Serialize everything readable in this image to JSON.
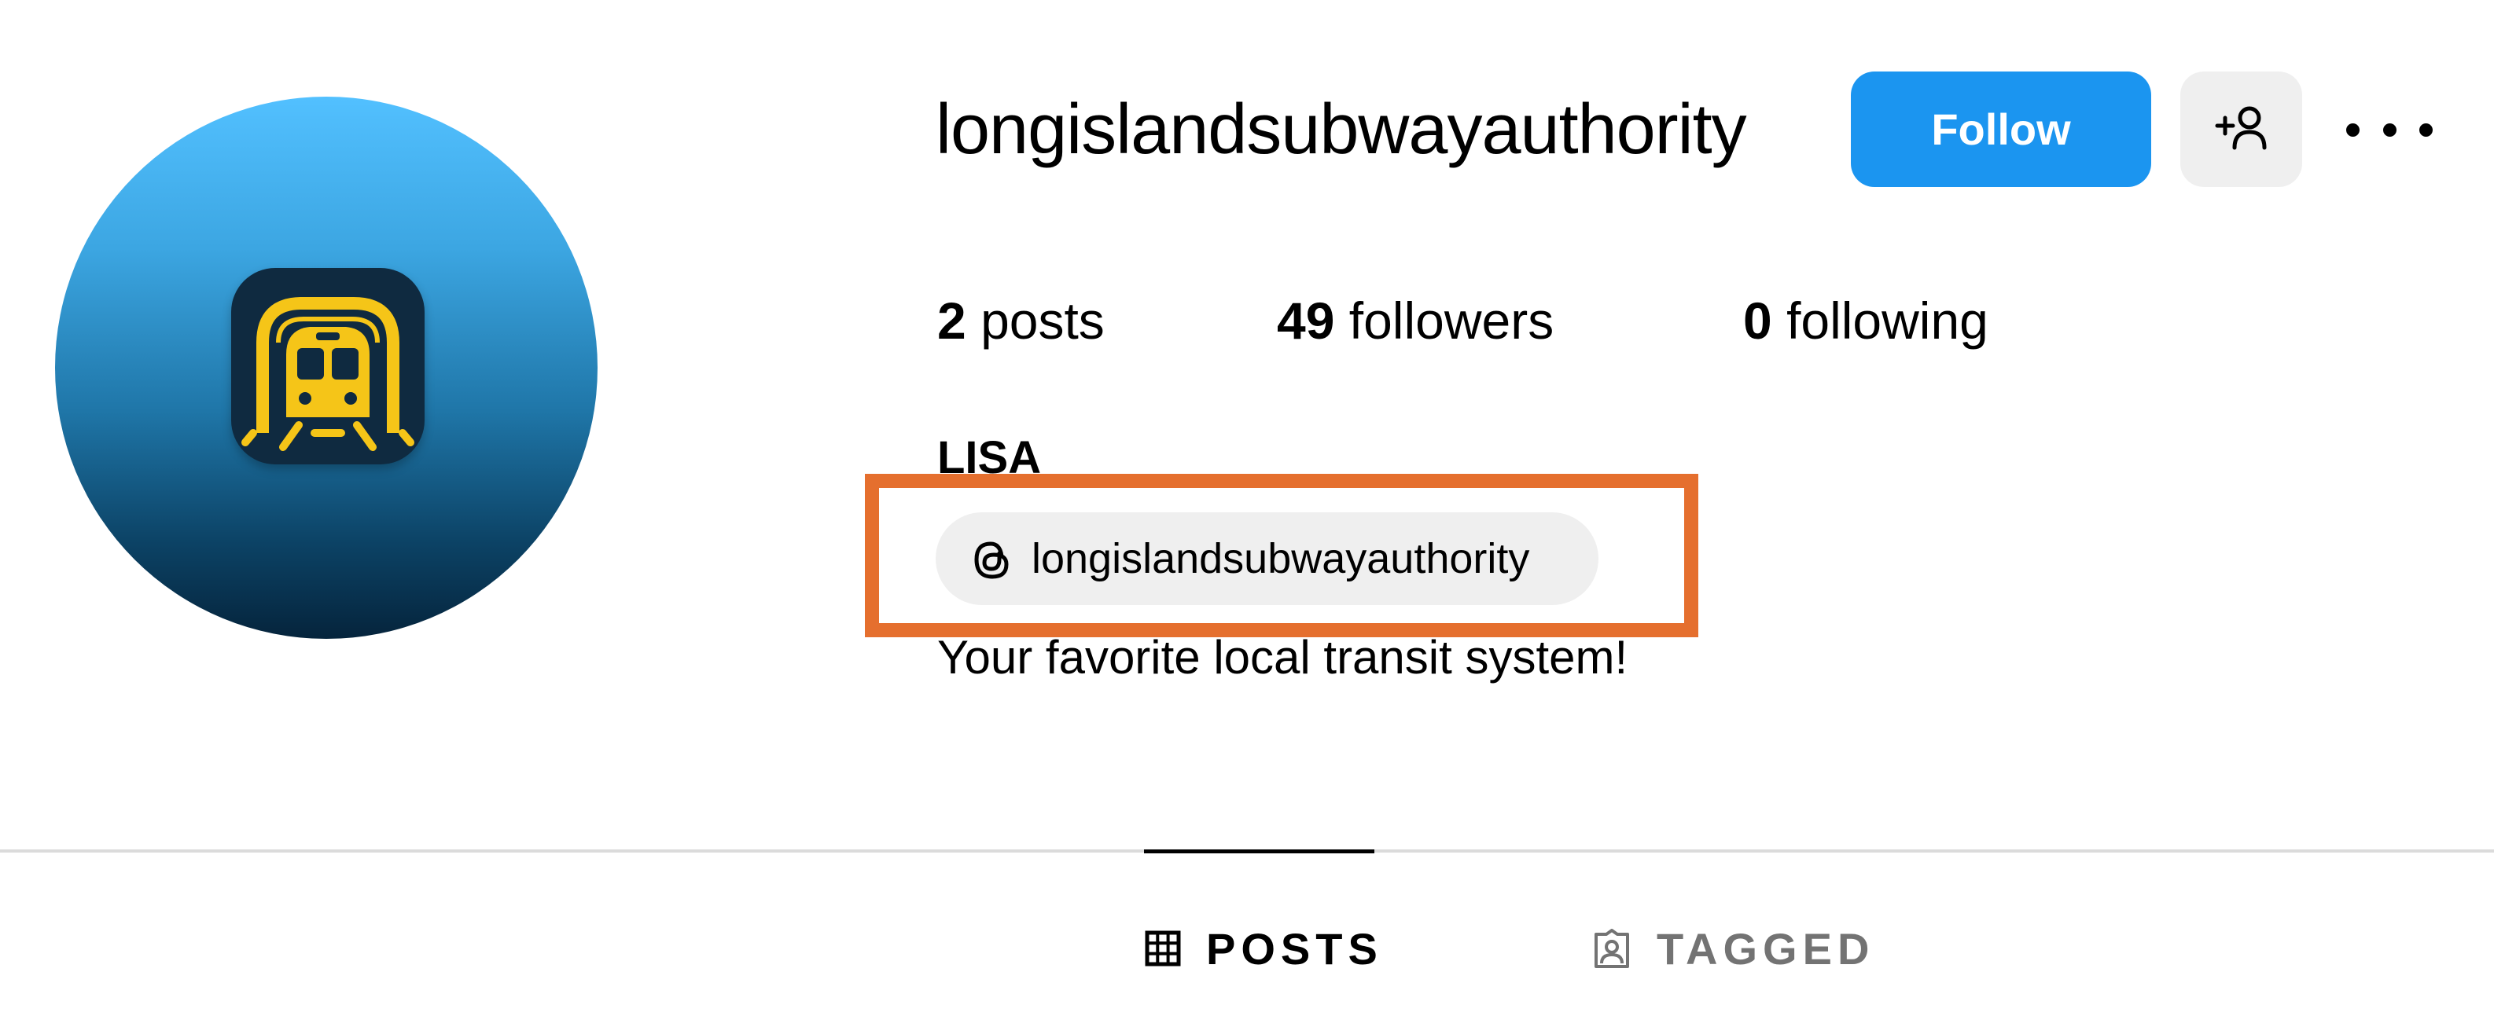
{
  "profile": {
    "username": "longislandsubwayauthority",
    "display_name": "LISA",
    "bio": "Your favorite local transit system!",
    "avatar_icon": "subway-train-icon",
    "threads": {
      "icon": "threads-icon",
      "label": "longislandsubwayauthority"
    }
  },
  "actions": {
    "follow_label": "Follow",
    "add_user_icon": "add-user-icon",
    "more_icon": "more-options-icon"
  },
  "stats": {
    "posts_count": "2",
    "posts_label": "posts",
    "followers_count": "49",
    "followers_label": "followers",
    "following_count": "0",
    "following_label": "following"
  },
  "tabs": [
    {
      "label": "POSTS",
      "icon": "grid-icon",
      "active": true
    },
    {
      "label": "TAGGED",
      "icon": "tagged-icon",
      "active": false
    }
  ],
  "colors": {
    "follow_button": "#1b95f0",
    "highlight_border": "#e56f2e",
    "chip_background": "#efefef",
    "inactive_tab": "#737373"
  }
}
